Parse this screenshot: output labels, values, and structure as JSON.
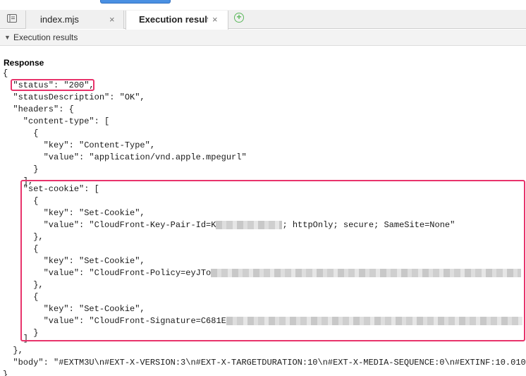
{
  "tabs": {
    "index": {
      "label": "index.mjs",
      "close": "×"
    },
    "exec": {
      "label": "Execution results",
      "close": "×"
    },
    "add": "+"
  },
  "section": {
    "caret": "▼",
    "title": "Execution results"
  },
  "response": {
    "title": "Response",
    "lines": [
      "{",
      "  \"status\": \"200\",",
      "  \"statusDescription\": \"OK\",",
      "  \"headers\": {",
      "    \"content-type\": [",
      "      {",
      "        \"key\": \"Content-Type\",",
      "        \"value\": \"application/vnd.apple.mpegurl\"",
      "      }",
      "    ],",
      "    \"set-cookie\": [",
      "      {",
      "        \"key\": \"Set-Cookie\",",
      "        \"value\": \"CloudFront-Key-Pair-Id=K",
      "      },",
      "      {",
      "        \"key\": \"Set-Cookie\",",
      "        \"value\": \"CloudFront-Policy=eyJTo",
      "      },",
      "      {",
      "        \"key\": \"Set-Cookie\",",
      "        \"value\": \"CloudFront-Signature=C681E",
      "      }",
      "    ]",
      "  },",
      "  \"body\": \"#EXTM3U\\n#EXT-X-VERSION:3\\n#EXT-X-TARGETDURATION:10\\n#EXT-X-MEDIA-SEQUENCE:0\\n#EXTINF:10.010",
      "}"
    ],
    "key_pair_suffix": "; httpOnly; secure; SameSite=None\""
  },
  "colors": {
    "highlight": "#e8336b",
    "add_tab": "#5cb85c",
    "accent": "#4a90e2"
  }
}
